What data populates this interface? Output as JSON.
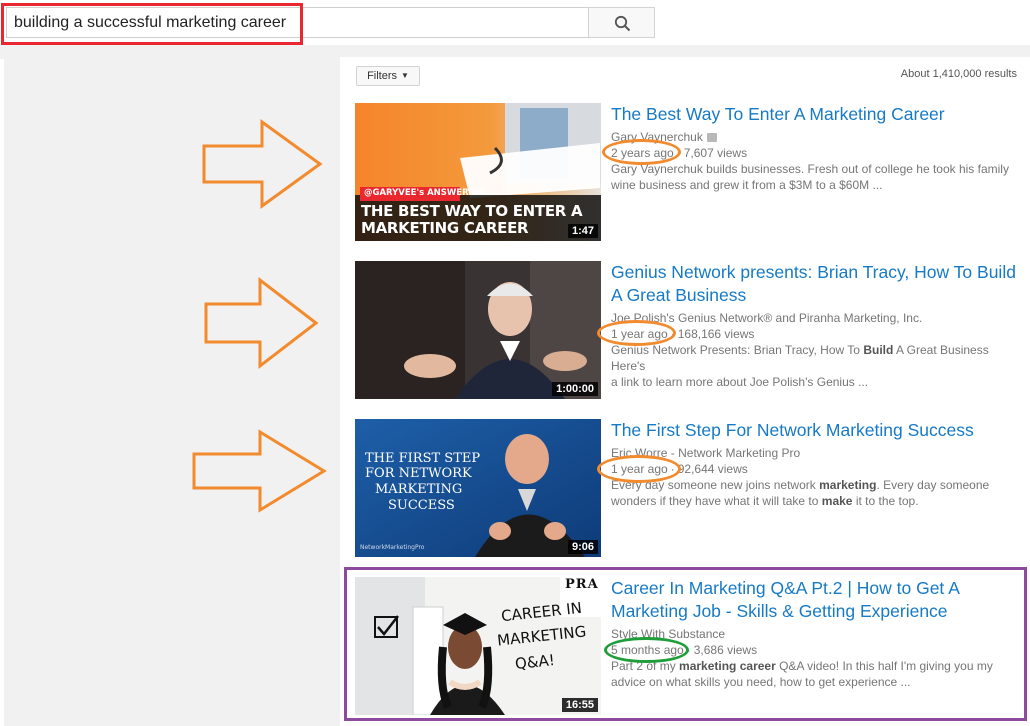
{
  "search": {
    "query": "building a successful marketing career"
  },
  "filters_label": "Filters",
  "result_count": "About 1,410,000 results",
  "results": [
    {
      "title": "The Best Way To Enter A Marketing Career",
      "channel": "Gary Vaynerchuk",
      "age": "2 years ago",
      "views": "7,607 views",
      "desc1": "Gary Vaynerchuk builds businesses. Fresh out of college he took his family",
      "desc2": "wine business and grew it from a $3M to a $60M ...",
      "duration": "1:47",
      "thumb_tag": "@GARYVEE's ANSWER ON...",
      "thumb_line1": "THE BEST WAY TO ENTER A",
      "thumb_line2": "MARKETING CAREER"
    },
    {
      "title": "Genius Network presents: Brian Tracy, How To Build A Great Business",
      "channel": "Joe Polish's Genius Network® and Piranha Marketing, Inc.",
      "age": "1 year ago",
      "views": "168,166 views",
      "desc1_pre": "Genius Network Presents: Brian Tracy, How To ",
      "desc1_bold": "Build",
      "desc1_post": " A Great Business Here's",
      "desc2": "a link to learn more about Joe Polish's Genius ...",
      "duration": "1:00:00"
    },
    {
      "title": "The First Step For Network Marketing Success",
      "channel": "Eric Worre - Network Marketing Pro",
      "age": "1 year ago",
      "views": "92,644 views",
      "desc1_pre": "Every day someone new joins network ",
      "desc1_bold": "marketing",
      "desc1_post": ". Every day someone",
      "desc2_pre": "wonders if they have what it will take to ",
      "desc2_bold": "make",
      "desc2_post": " it to the top.",
      "duration": "9:06",
      "thumb_text": [
        "THE FIRST STEP",
        "FOR NETWORK",
        "MARKETING",
        "SUCCESS"
      ],
      "thumb_footer": "NetworkMarketingPro"
    },
    {
      "title": "Career In Marketing Q&A Pt.2 | How to Get A Marketing Job - Skills & Getting Experience",
      "channel": "Style With Substance",
      "age": "5 months ago",
      "views": "3,686 views",
      "desc1_pre": "Part 2 of my ",
      "desc1_bold": "marketing career",
      "desc1_post": " Q&A video! In this half I'm giving you my",
      "desc2": "advice on what skills you need, how to get experience ...",
      "duration": "16:55",
      "thumb_text": [
        "CAREER IN",
        "MARKETING",
        "Q&A!"
      ],
      "thumb_sign": "PRA"
    }
  ],
  "colors": {
    "link": "#167ac6",
    "meta": "#767676",
    "annotation_orange": "#f28a2e",
    "annotation_green": "#1f9e3a",
    "annotation_red": "#e8282e",
    "annotation_purple": "#8e4a9e"
  }
}
